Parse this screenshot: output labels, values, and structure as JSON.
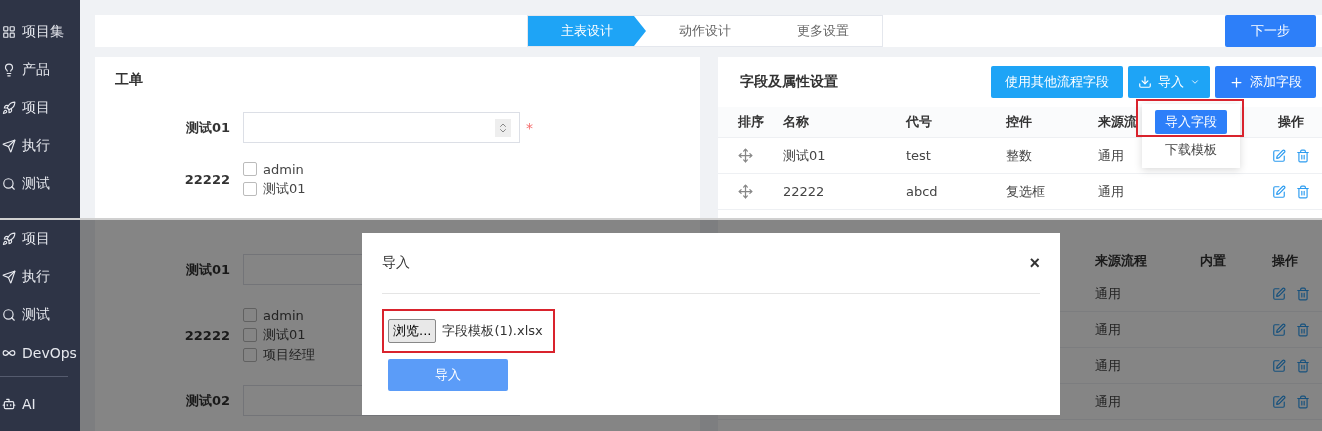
{
  "top": {
    "sidebar": [
      {
        "label": "项目集"
      },
      {
        "label": "产品"
      },
      {
        "label": "项目"
      },
      {
        "label": "执行"
      },
      {
        "label": "测试"
      }
    ],
    "steps": [
      {
        "label": "主表设计",
        "selected": true
      },
      {
        "label": "动作设计",
        "selected": false
      },
      {
        "label": "更多设置",
        "selected": false
      }
    ],
    "next_button": "下一步",
    "form": {
      "title": "工单",
      "fields": [
        {
          "kind": "number",
          "label": "测试01",
          "required_mark": "*"
        },
        {
          "kind": "checkboxes",
          "label": "22222",
          "options": [
            {
              "label": "admin",
              "checked": false
            },
            {
              "label": "测试01",
              "checked": false
            }
          ]
        }
      ]
    },
    "fields_panel": {
      "title": "字段及属性设置",
      "other_fields_button": "使用其他流程字段",
      "import_button": "导入",
      "add_button": "添加字段",
      "import_menu": [
        {
          "label": "导入字段",
          "selected": true
        },
        {
          "label": "下载模板",
          "selected": false
        }
      ],
      "columns": [
        "排序",
        "名称",
        "代号",
        "控件",
        "来源流",
        "操作"
      ],
      "rows": [
        {
          "name": "测试01",
          "code": "test",
          "control": "整数",
          "source": "通用"
        },
        {
          "name": "22222",
          "code": "abcd",
          "control": "复选框",
          "source": "通用"
        }
      ]
    }
  },
  "bottom": {
    "sidebar": [
      {
        "label": "项目"
      },
      {
        "label": "执行"
      },
      {
        "label": "测试"
      },
      {
        "label": "DevOps"
      },
      {
        "label": "AI"
      }
    ],
    "form": {
      "fields": [
        {
          "kind": "text",
          "label": "测试01"
        },
        {
          "kind": "checkboxes",
          "label": "22222",
          "options": [
            {
              "label": "admin",
              "checked": false
            },
            {
              "label": "测试01",
              "checked": false
            },
            {
              "label": "项目经理",
              "checked": false
            }
          ]
        },
        {
          "kind": "text",
          "label": "测试02"
        }
      ]
    },
    "table": {
      "columns": [
        "来源流程",
        "内置",
        "操作"
      ],
      "rows": [
        {
          "source": "通用"
        },
        {
          "source": "通用"
        },
        {
          "source": "通用"
        },
        {
          "source": "通用"
        }
      ]
    },
    "dialog": {
      "title": "导入",
      "close": "×",
      "browse_button": "浏览...",
      "file_name": "字段模板(1).xlsx",
      "import_button": "导入"
    }
  }
}
